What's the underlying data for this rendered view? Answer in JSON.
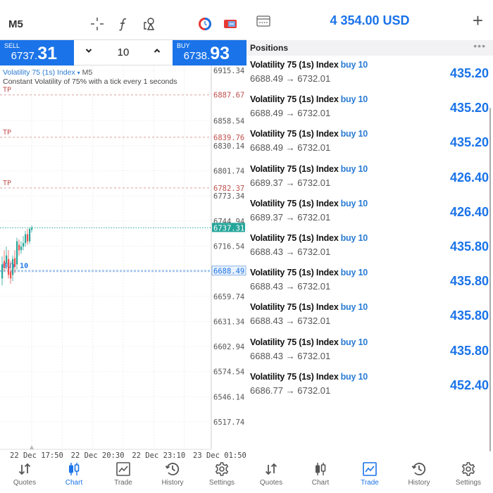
{
  "chart_panel": {
    "timeframe": "M5",
    "toolbar_icons": [
      "crosshair-icon",
      "indicators-icon",
      "objects-icon",
      "timeframe-clock-icon",
      "trading-toggle-icon"
    ],
    "sell": {
      "caption": "SELL",
      "price_prefix": "6737.",
      "price_suffix": "31"
    },
    "buy": {
      "caption": "BUY",
      "price_prefix": "6738.",
      "price_suffix": "93"
    },
    "volume": {
      "value": "10",
      "down": "⌄",
      "up": "⌃"
    },
    "symbol": "Volatility 75 (1s) Index",
    "symbol_caret": "▾",
    "symbol_tf": "M5",
    "description": "Constant Volatility of 75% with a tick every 1 seconds",
    "price_axis": [
      "6915.34",
      "6858.54",
      "6830.14",
      "6801.74",
      "6773.34",
      "6744.94",
      "6716.54",
      "6659.74",
      "6631.34",
      "6602.94",
      "6574.54",
      "6546.14",
      "6517.74"
    ],
    "tp_levels": [
      {
        "label": "TP",
        "price": "6887.67"
      },
      {
        "label": "TP",
        "price": "6839.76"
      },
      {
        "label": "TP",
        "price": "6782.37"
      }
    ],
    "current_price": "6737.31",
    "buy_level": {
      "label": "BUY 10",
      "price": "6688.49"
    },
    "time_axis": [
      "22 Dec 17:50",
      "22 Dec 20:30",
      "22 Dec 23:10",
      "23 Dec 01:50"
    ],
    "colors": {
      "accent": "#1a73e8",
      "tp": "#c0504d",
      "current": "#26a69a",
      "bull": "#26a69a",
      "bear": "#ef5350"
    }
  },
  "chart_tabs": [
    {
      "label": "Quotes",
      "icon": "quotes-icon",
      "active": false
    },
    {
      "label": "Chart",
      "icon": "chart-icon",
      "active": true
    },
    {
      "label": "Trade",
      "icon": "trade-icon",
      "active": false
    },
    {
      "label": "History",
      "icon": "history-icon",
      "active": false
    },
    {
      "label": "Settings",
      "icon": "settings-icon",
      "active": false
    }
  ],
  "trade_panel": {
    "balance": "4 354.00 USD",
    "add_label": "+",
    "positions_title": "Positions",
    "more_label": "•••",
    "positions": [
      {
        "symbol": "Volatility 75 (1s) Index",
        "side": "buy 10",
        "open": "6688.49",
        "arrow": "→",
        "current": "6732.01",
        "profit": "435.20"
      },
      {
        "symbol": "Volatility 75 (1s) Index",
        "side": "buy 10",
        "open": "6688.49",
        "arrow": "→",
        "current": "6732.01",
        "profit": "435.20"
      },
      {
        "symbol": "Volatility 75 (1s) Index",
        "side": "buy 10",
        "open": "6688.49",
        "arrow": "→",
        "current": "6732.01",
        "profit": "435.20"
      },
      {
        "symbol": "Volatility 75 (1s) Index",
        "side": "buy 10",
        "open": "6689.37",
        "arrow": "→",
        "current": "6732.01",
        "profit": "426.40"
      },
      {
        "symbol": "Volatility 75 (1s) Index",
        "side": "buy 10",
        "open": "6689.37",
        "arrow": "→",
        "current": "6732.01",
        "profit": "426.40"
      },
      {
        "symbol": "Volatility 75 (1s) Index",
        "side": "buy 10",
        "open": "6688.43",
        "arrow": "→",
        "current": "6732.01",
        "profit": "435.80"
      },
      {
        "symbol": "Volatility 75 (1s) Index",
        "side": "buy 10",
        "open": "6688.43",
        "arrow": "→",
        "current": "6732.01",
        "profit": "435.80"
      },
      {
        "symbol": "Volatility 75 (1s) Index",
        "side": "buy 10",
        "open": "6688.43",
        "arrow": "→",
        "current": "6732.01",
        "profit": "435.80"
      },
      {
        "symbol": "Volatility 75 (1s) Index",
        "side": "buy 10",
        "open": "6688.43",
        "arrow": "→",
        "current": "6732.01",
        "profit": "435.80"
      },
      {
        "symbol": "Volatility 75 (1s) Index",
        "side": "buy 10",
        "open": "6686.77",
        "arrow": "→",
        "current": "6732.01",
        "profit": "452.40"
      }
    ]
  },
  "trade_tabs": [
    {
      "label": "Quotes",
      "icon": "quotes-icon",
      "active": false
    },
    {
      "label": "Chart",
      "icon": "chart-icon",
      "active": false
    },
    {
      "label": "Trade",
      "icon": "trade-icon",
      "active": true
    },
    {
      "label": "History",
      "icon": "history-icon",
      "active": false
    },
    {
      "label": "Settings",
      "icon": "settings-icon",
      "active": false
    }
  ]
}
